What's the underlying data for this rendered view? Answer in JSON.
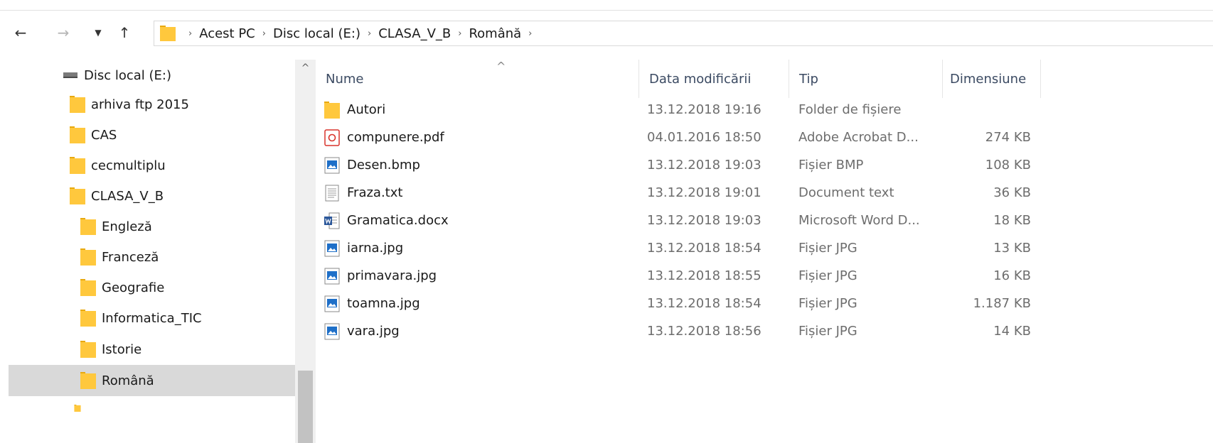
{
  "nav": {
    "back_icon": "arrow-left-icon",
    "forward_icon": "arrow-right-icon",
    "recent_icon": "chevron-down-icon",
    "up_icon": "arrow-up-icon"
  },
  "breadcrumb": [
    "Acest PC",
    "Disc local (E:)",
    "CLASA_V_B",
    "Română"
  ],
  "sidebar": {
    "items": [
      {
        "label": "Disc local (E:)",
        "icon": "drive-icon",
        "indent": 0
      },
      {
        "label": "arhiva ftp 2015",
        "icon": "folder-icon",
        "indent": 1
      },
      {
        "label": "CAS",
        "icon": "folder-icon",
        "indent": 1
      },
      {
        "label": "cecmultiplu",
        "icon": "folder-icon",
        "indent": 1
      },
      {
        "label": "CLASA_V_B",
        "icon": "folder-icon",
        "indent": 1
      },
      {
        "label": "Engleză",
        "icon": "folder-icon",
        "indent": 2
      },
      {
        "label": "Franceză",
        "icon": "folder-icon",
        "indent": 2
      },
      {
        "label": "Geografie",
        "icon": "folder-icon",
        "indent": 2
      },
      {
        "label": "Informatica_TIC",
        "icon": "folder-icon",
        "indent": 2
      },
      {
        "label": "Istorie",
        "icon": "folder-icon",
        "indent": 2
      },
      {
        "label": "Română",
        "icon": "folder-icon",
        "indent": 2,
        "selected": true
      }
    ]
  },
  "columns": {
    "name": "Nume",
    "date": "Data modificării",
    "type": "Tip",
    "size": "Dimensiune"
  },
  "files": [
    {
      "name": "Autori",
      "date": "13.12.2018 19:16",
      "type": "Folder de fișiere",
      "size": "",
      "icon": "folder-icon"
    },
    {
      "name": "compunere.pdf",
      "date": "04.01.2016 18:50",
      "type": "Adobe Acrobat D...",
      "size": "274 KB",
      "icon": "pdf-icon"
    },
    {
      "name": "Desen.bmp",
      "date": "13.12.2018 19:03",
      "type": "Fișier BMP",
      "size": "108 KB",
      "icon": "image-icon"
    },
    {
      "name": "Fraza.txt",
      "date": "13.12.2018 19:01",
      "type": "Document text",
      "size": "36 KB",
      "icon": "text-file-icon"
    },
    {
      "name": "Gramatica.docx",
      "date": "13.12.2018 19:03",
      "type": "Microsoft Word D...",
      "size": "18 KB",
      "icon": "word-icon"
    },
    {
      "name": "iarna.jpg",
      "date": "13.12.2018 18:54",
      "type": "Fișier JPG",
      "size": "13 KB",
      "icon": "image-icon"
    },
    {
      "name": "primavara.jpg",
      "date": "13.12.2018 18:55",
      "type": "Fișier JPG",
      "size": "16 KB",
      "icon": "image-icon"
    },
    {
      "name": "toamna.jpg",
      "date": "13.12.2018 18:54",
      "type": "Fișier JPG",
      "size": "1.187 KB",
      "icon": "image-icon"
    },
    {
      "name": "vara.jpg",
      "date": "13.12.2018 18:56",
      "type": "Fișier JPG",
      "size": "14 KB",
      "icon": "image-icon"
    }
  ],
  "colors": {
    "folder": "#ffc83d",
    "folder_dark": "#e8a90f",
    "selected_bg": "#d9d9d9",
    "header_text": "#3b4a62",
    "pdf_red": "#d9332b",
    "word_blue": "#2b579a",
    "image_blue": "#1e6fc8"
  }
}
